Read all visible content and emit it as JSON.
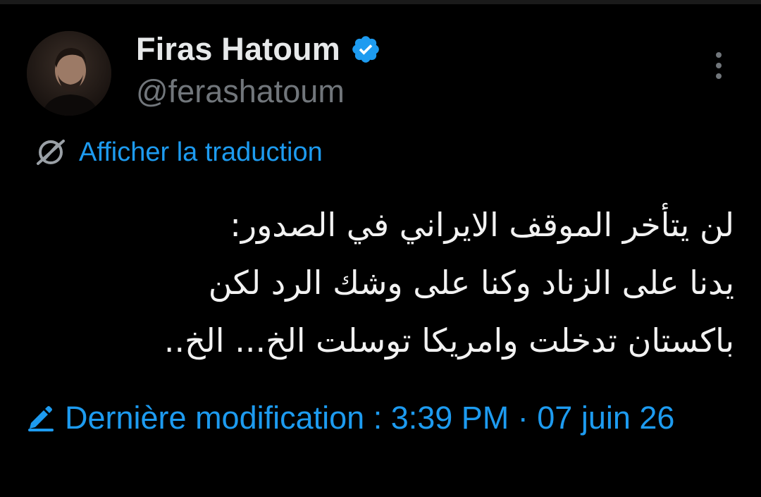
{
  "author": {
    "display_name": "Firas Hatoum",
    "handle": "@ferashatoum",
    "verified_icon": "verified-badge-icon",
    "avatar_icon": "avatar"
  },
  "translate": {
    "label": "Afficher la traduction",
    "icon": "globe-icon"
  },
  "tweet": {
    "lines": [
      "لن يتأخر الموقف الايراني في الصدور:",
      "يدنا على الزناد وكنا على وشك الرد لكن",
      "باكستان تدخلت وامريكا توسلت الخ... الخ.."
    ]
  },
  "edited": {
    "text": "Dernière modification : 3:39 PM · 07 juin 26",
    "icon": "pencil-icon"
  },
  "menu": {
    "icon": "more-vertical-icon"
  },
  "colors": {
    "background": "#000000",
    "text_primary": "#e7e9ea",
    "text_secondary": "#71767b",
    "accent": "#1d9bf0"
  }
}
